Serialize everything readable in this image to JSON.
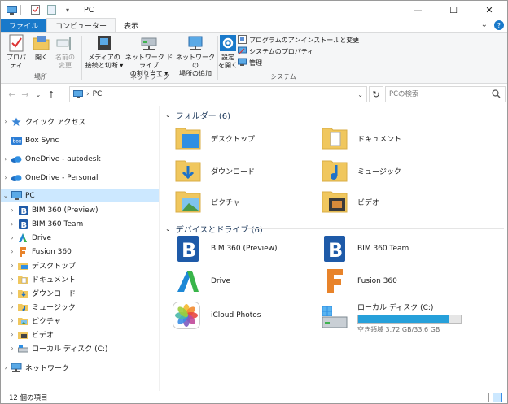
{
  "window": {
    "title": "PC",
    "controls": {
      "minimize": "—",
      "maximize": "☐",
      "close": "✕"
    }
  },
  "tabs": [
    "ファイル",
    "コンピューター",
    "表示"
  ],
  "ribbon": {
    "location_group": {
      "label": "場所",
      "buttons": [
        "プロパティ",
        "開く",
        "名前の\n変更"
      ]
    },
    "network_group": {
      "label": "ネットワーク",
      "buttons": [
        "メディアの\n接続と切断 ▾",
        "ネットワーク ドライブ\nの割り当て ▾",
        "ネットワークの\n場所の追加"
      ]
    },
    "system_group": {
      "label": "システム",
      "open_settings": "設定\nを開く",
      "items": [
        "プログラムのアンインストールと変更",
        "システムのプロパティ",
        "管理"
      ]
    }
  },
  "address": {
    "path": "PC",
    "search_placeholder": "PCの検索"
  },
  "nav": {
    "items": [
      {
        "label": "クイック アクセス",
        "icon": "star-icon",
        "chevron": "›",
        "level": 0
      },
      {
        "label": "Box Sync",
        "icon": "box-icon",
        "chevron": "",
        "level": 0
      },
      {
        "label": "OneDrive - autodesk",
        "icon": "cloud-icon",
        "chevron": "›",
        "level": 0
      },
      {
        "label": "OneDrive - Personal",
        "icon": "cloud-icon",
        "chevron": "›",
        "level": 0
      },
      {
        "label": "PC",
        "icon": "pc-icon",
        "chevron": "⌄",
        "level": 0,
        "selected": true
      },
      {
        "label": "BIM 360 (Preview)",
        "icon": "bim-icon",
        "chevron": "›",
        "level": 1
      },
      {
        "label": "BIM 360 Team",
        "icon": "bim-icon",
        "chevron": "›",
        "level": 1
      },
      {
        "label": "Drive",
        "icon": "drive-a-icon",
        "chevron": "›",
        "level": 1
      },
      {
        "label": "Fusion 360",
        "icon": "fusion-icon",
        "chevron": "›",
        "level": 1
      },
      {
        "label": "デスクトップ",
        "icon": "folder-icon",
        "chevron": "›",
        "level": 1
      },
      {
        "label": "ドキュメント",
        "icon": "folder-icon",
        "chevron": "›",
        "level": 1
      },
      {
        "label": "ダウンロード",
        "icon": "folder-icon",
        "chevron": "›",
        "level": 1
      },
      {
        "label": "ミュージック",
        "icon": "folder-icon",
        "chevron": "›",
        "level": 1
      },
      {
        "label": "ピクチャ",
        "icon": "folder-icon",
        "chevron": "›",
        "level": 1
      },
      {
        "label": "ビデオ",
        "icon": "folder-icon",
        "chevron": "›",
        "level": 1
      },
      {
        "label": "ローカル ディスク (C:)",
        "icon": "disk-icon",
        "chevron": "›",
        "level": 1
      },
      {
        "label": "ネットワーク",
        "icon": "network-icon",
        "chevron": "›",
        "level": 0
      }
    ]
  },
  "content": {
    "folders_header": "フォルダー (6)",
    "folders": [
      "デスクトップ",
      "ドキュメント",
      "ダウンロード",
      "ミュージック",
      "ピクチャ",
      "ビデオ"
    ],
    "devices_header": "デバイスとドライブ (6)",
    "devices": [
      "BIM 360 (Preview)",
      "BIM 360 Team",
      "Drive",
      "Fusion 360",
      "iCloud Photos"
    ],
    "local_disk": {
      "label": "ローカル ディスク (C:)",
      "free_text": "空き領域 3.72 GB/33.6 GB",
      "used_fraction": 0.889
    }
  },
  "status": {
    "item_count": "12 個の項目"
  },
  "colors": {
    "accent": "#1979ca",
    "selection": "#cce8ff",
    "folder": "#f0c75e",
    "drive_fill": "#26a0da"
  }
}
